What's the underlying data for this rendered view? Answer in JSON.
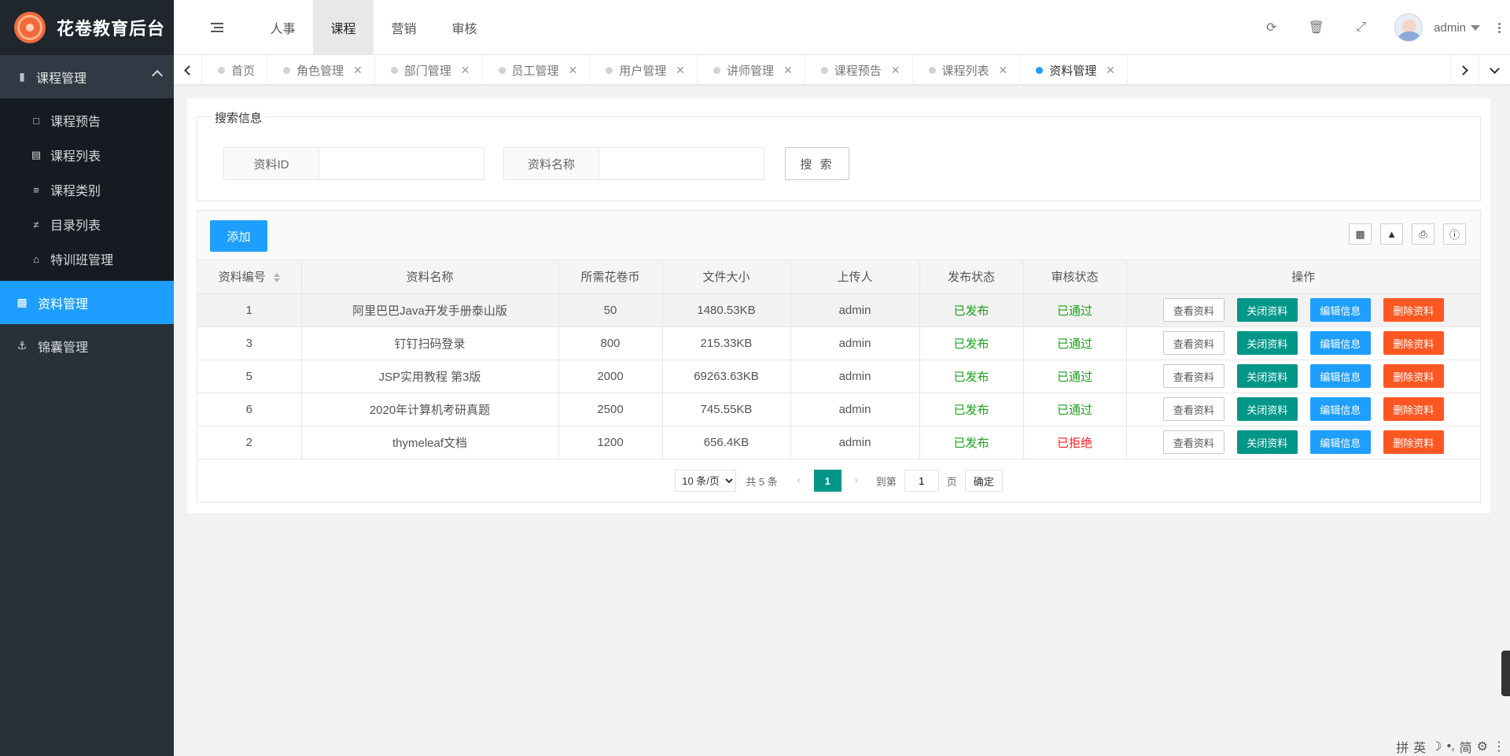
{
  "app": {
    "title": "花卷教育后台"
  },
  "sidebar": {
    "group": {
      "label": "课程管理",
      "items": [
        {
          "label": "课程预告",
          "icon": "preview-icon"
        },
        {
          "label": "课程列表",
          "icon": "list-icon"
        },
        {
          "label": "课程类别",
          "icon": "category-icon"
        },
        {
          "label": "目录列表",
          "icon": "sliders-icon"
        },
        {
          "label": "特训班管理",
          "icon": "bank-icon"
        }
      ]
    },
    "active": {
      "label": "资料管理"
    },
    "other": {
      "label": "锦囊管理"
    }
  },
  "topnav": {
    "items": [
      "人事",
      "课程",
      "营销",
      "审核"
    ],
    "active": "课程"
  },
  "user": {
    "name": "admin"
  },
  "tabs": [
    {
      "label": "首页",
      "closable": false
    },
    {
      "label": "角色管理",
      "closable": true
    },
    {
      "label": "部门管理",
      "closable": true
    },
    {
      "label": "员工管理",
      "closable": true
    },
    {
      "label": "用户管理",
      "closable": true
    },
    {
      "label": "讲师管理",
      "closable": true
    },
    {
      "label": "课程预告",
      "closable": true
    },
    {
      "label": "课程列表",
      "closable": true
    },
    {
      "label": "资料管理",
      "closable": true,
      "active": true
    }
  ],
  "search": {
    "legend": "搜索信息",
    "id_label": "资料ID",
    "id_value": "",
    "name_label": "资料名称",
    "name_value": "",
    "button": "搜 索"
  },
  "toolbar": {
    "add_label": "添加"
  },
  "table": {
    "columns": [
      "资料编号",
      "资料名称",
      "所需花卷币",
      "文件大小",
      "上传人",
      "发布状态",
      "审核状态",
      "操作"
    ],
    "rows": [
      {
        "id": "1",
        "name": "阿里巴巴Java开发手册泰山版",
        "coins": "50",
        "size": "1480.53KB",
        "uploader": "admin",
        "publish": "已发布",
        "audit": "已通过",
        "audit_ok": true
      },
      {
        "id": "3",
        "name": "钉钉扫码登录",
        "coins": "800",
        "size": "215.33KB",
        "uploader": "admin",
        "publish": "已发布",
        "audit": "已通过",
        "audit_ok": true
      },
      {
        "id": "5",
        "name": "JSP实用教程 第3版",
        "coins": "2000",
        "size": "69263.63KB",
        "uploader": "admin",
        "publish": "已发布",
        "audit": "已通过",
        "audit_ok": true
      },
      {
        "id": "6",
        "name": "2020年计算机考研真题",
        "coins": "2500",
        "size": "745.55KB",
        "uploader": "admin",
        "publish": "已发布",
        "audit": "已通过",
        "audit_ok": true
      },
      {
        "id": "2",
        "name": "thymeleaf文档",
        "coins": "1200",
        "size": "656.4KB",
        "uploader": "admin",
        "publish": "已发布",
        "audit": "已拒绝",
        "audit_ok": false
      }
    ],
    "actions": {
      "view": "查看资料",
      "close": "关闭资料",
      "edit": "编辑信息",
      "delete": "删除资料"
    }
  },
  "pager": {
    "page_size": "10 条/页",
    "total": "共 5 条",
    "current": "1",
    "goto_label": "到第",
    "goto_value": "1",
    "page_unit": "页",
    "confirm": "确定"
  },
  "ime": [
    "拼",
    "英",
    "☽",
    "•,",
    "简",
    "⚙",
    "⋮"
  ],
  "colors": {
    "primary": "#1e9fff",
    "green": "#009688",
    "orange": "#ff5722",
    "sidebar": "#283139"
  }
}
